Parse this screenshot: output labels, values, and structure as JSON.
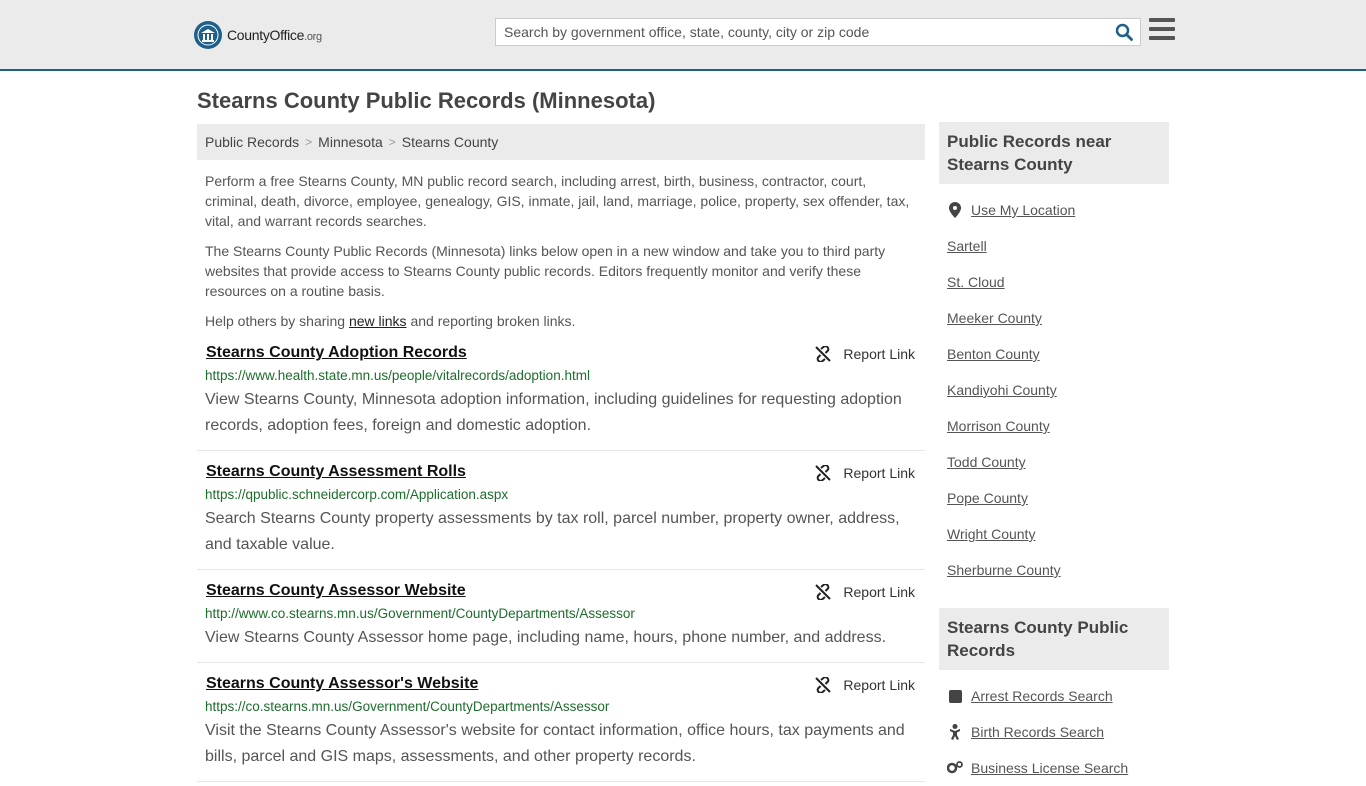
{
  "header": {
    "logo_name": "CountyOffice",
    "logo_tld": ".org",
    "search_placeholder": "Search by government office, state, county, city or zip code"
  },
  "page_title": "Stearns County Public Records (Minnesota)",
  "breadcrumb": [
    "Public Records",
    "Minnesota",
    "Stearns County"
  ],
  "intro": {
    "p1": "Perform a free Stearns County, MN public record search, including arrest, birth, business, contractor, court, criminal, death, divorce, employee, genealogy, GIS, inmate, jail, land, marriage, police, property, sex offender, tax, vital, and warrant records searches.",
    "p2": "The Stearns County Public Records (Minnesota) links below open in a new window and take you to third party websites that provide access to Stearns County public records. Editors frequently monitor and verify these resources on a routine basis.",
    "p3_before": "Help others by sharing ",
    "p3_link": "new links",
    "p3_after": " and reporting broken links."
  },
  "report_label": "Report Link",
  "records": [
    {
      "title": "Stearns County Adoption Records",
      "url": "https://www.health.state.mn.us/people/vitalrecords/adoption.html",
      "desc": "View Stearns County, Minnesota adoption information, including guidelines for requesting adoption records, adoption fees, foreign and domestic adoption."
    },
    {
      "title": "Stearns County Assessment Rolls",
      "url": "https://qpublic.schneidercorp.com/Application.aspx",
      "desc": "Search Stearns County property assessments by tax roll, parcel number, property owner, address, and taxable value."
    },
    {
      "title": "Stearns County Assessor Website",
      "url": "http://www.co.stearns.mn.us/Government/CountyDepartments/Assessor",
      "desc": "View Stearns County Assessor home page, including name, hours, phone number, and address."
    },
    {
      "title": "Stearns County Assessor's Website",
      "url": "https://co.stearns.mn.us/Government/CountyDepartments/Assessor",
      "desc": "Visit the Stearns County Assessor's website for contact information, office hours, tax payments and bills, parcel and GIS maps, assessments, and other property records."
    }
  ],
  "sidebar": {
    "near_title": "Public Records near Stearns County",
    "use_location": "Use My Location",
    "near_items": [
      "Sartell",
      "St. Cloud",
      "Meeker County",
      "Benton County",
      "Kandiyohi County",
      "Morrison County",
      "Todd County",
      "Pope County",
      "Wright County",
      "Sherburne County"
    ],
    "records_title": "Stearns County Public Records",
    "record_items": [
      {
        "label": "Arrest Records Search",
        "icon": "square-icon"
      },
      {
        "label": "Birth Records Search",
        "icon": "baby-icon"
      },
      {
        "label": "Business License Search",
        "icon": "gears-icon"
      }
    ]
  },
  "colors": {
    "accent": "#1f5f8b",
    "url_green": "#1d6d2c",
    "panel_gray": "#ebebeb"
  }
}
